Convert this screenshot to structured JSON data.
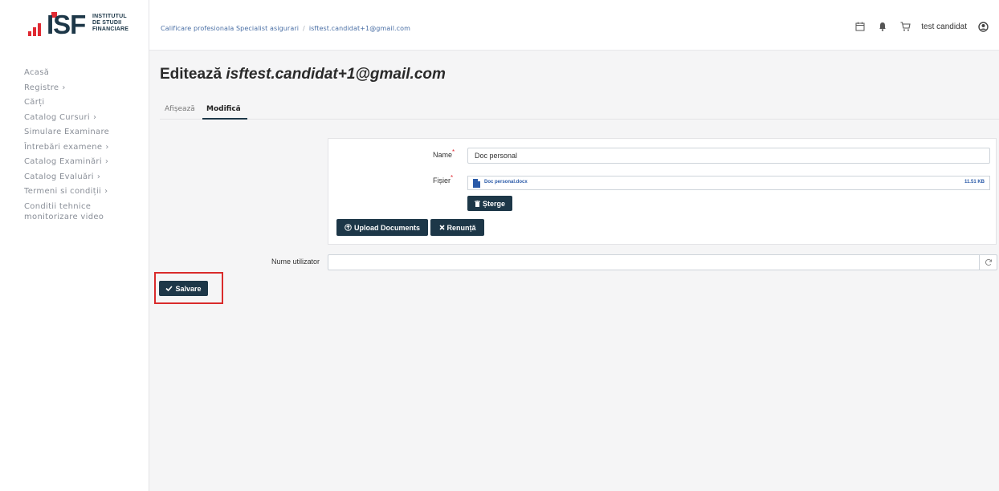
{
  "logo": {
    "brand": "ISF",
    "line1": "INSTITUTUL",
    "line2": "DE STUDII",
    "line3": "FINANCIARE",
    "accent_color": "#e02a33",
    "brand_color": "#1d3748"
  },
  "sidebar": {
    "items": [
      {
        "label": "Acasă",
        "chev": ""
      },
      {
        "label": "Registre",
        "chev": "›"
      },
      {
        "label": "Cărți",
        "chev": ""
      },
      {
        "label": "Catalog Cursuri",
        "chev": "›"
      },
      {
        "label": "Simulare Examinare",
        "chev": ""
      },
      {
        "label": "Întrebări examene",
        "chev": "›"
      },
      {
        "label": "Catalog Examinări",
        "chev": "›"
      },
      {
        "label": "Catalog Evaluări",
        "chev": "›"
      },
      {
        "label": "Termeni si condiții",
        "chev": "›"
      },
      {
        "label": "Conditii tehnice monitorizare video",
        "chev": ""
      }
    ]
  },
  "header": {
    "breadcrumb": [
      "Calificare profesionala Specialist asigurari",
      "isftest.candidat+1@gmail.com"
    ],
    "separator": "/",
    "icons": [
      "calendar-icon",
      "bell-icon",
      "cart-icon",
      "user-circle-icon"
    ],
    "user_name": "test candidat"
  },
  "main": {
    "title_prefix": "Editează",
    "title_email": "isftest.candidat+1@gmail.com",
    "tabs": [
      {
        "label": "Afișează",
        "active": false
      },
      {
        "label": "Modifică",
        "active": true
      }
    ],
    "form": {
      "name_label": "Name",
      "name_value": "Doc personal",
      "file_label": "Fișier",
      "required_mark": "*",
      "file_name": "Doc personal.docx",
      "file_size": "11.51 KB",
      "delete_label": "Șterge",
      "upload_label": "Upload Documents",
      "cancel_label": "Renunță",
      "username_label": "Nume utilizator",
      "username_value": "",
      "save_label": "Salvare"
    }
  }
}
